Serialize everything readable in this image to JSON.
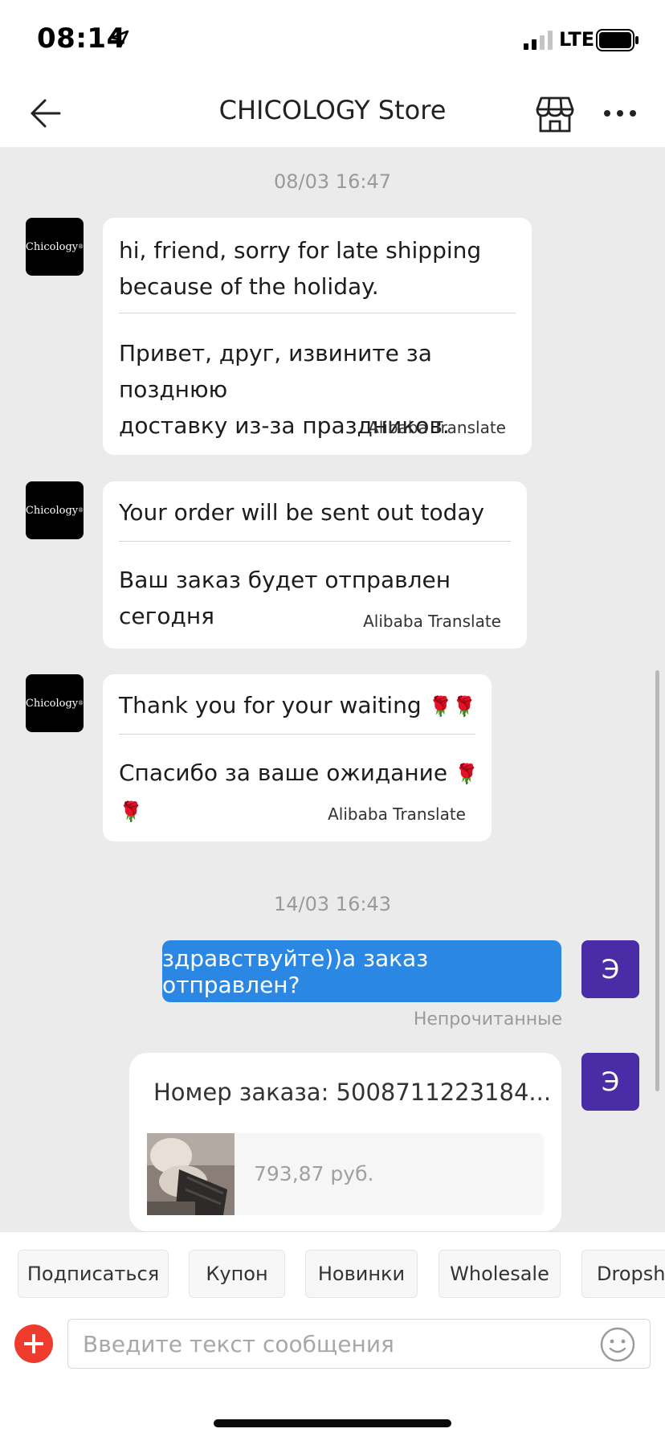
{
  "status_bar": {
    "time": "08:14",
    "network": "LTE"
  },
  "header": {
    "title": "CHICOLOGY Store",
    "back_icon": "arrow-left-icon",
    "store_icon": "store-icon",
    "more_icon": "more-dots-icon"
  },
  "chat": {
    "timestamps": [
      "08/03 16:47",
      "14/03 16:43"
    ],
    "store_avatar_text": "Chicology",
    "messages": [
      {
        "original_line1": "hi, friend, sorry for late shipping",
        "original_line2": "because of the holiday.",
        "translation_line1": "Привет, друг, извините за позднюю",
        "translation_line2": "доставку из-за праздников.",
        "credit": "Alibaba Translate"
      },
      {
        "original_line1": "Your order will be sent out today",
        "translation_line1": "Ваш заказ будет отправлен сегодня",
        "credit": "Alibaba Translate"
      },
      {
        "original_line1": "Thank you for your waiting",
        "translation_line1": "Спасибо за ваше ожидание",
        "emoji": "🌹🌹",
        "credit": "Alibaba Translate"
      }
    ],
    "user_avatar_letter": "Э",
    "outgoing": {
      "text": "здравствуйте))а заказ отправлен?",
      "status": "Непрочитанные"
    },
    "order_card": {
      "title": "Номер заказа: 5008711223184...",
      "price": "793,87 руб."
    }
  },
  "quick_actions": [
    "Подписаться",
    "Купон",
    "Новинки",
    "Wholesale",
    "Dropshi"
  ],
  "composer": {
    "placeholder": "Введите текст сообщения",
    "plus_icon": "plus-icon",
    "emoji_icon": "smiley-icon"
  },
  "colors": {
    "accent_blue": "#2a88e4",
    "user_avatar": "#4a2da6",
    "plus_red": "#ee3b2e",
    "background": "#ebebeb"
  }
}
